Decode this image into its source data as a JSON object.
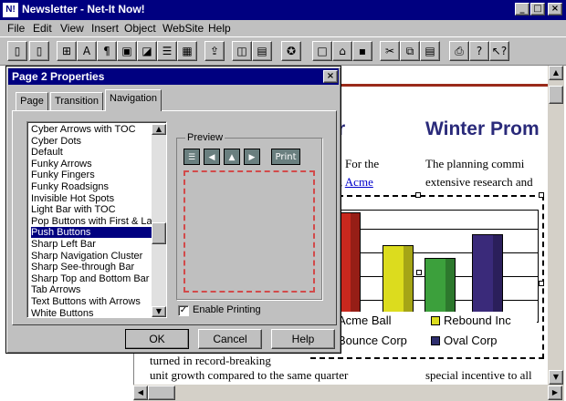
{
  "app": {
    "title": "Newsletter - Net-It Now!",
    "icon_name": "net-it-app-icon",
    "icon_glyph": "N!"
  },
  "menu": {
    "items": [
      "File",
      "Edit",
      "View",
      "Insert",
      "Object",
      "WebSite",
      "Help"
    ]
  },
  "toolbar": {
    "icons": [
      "page-icon",
      "pages-icon",
      "grid-icon",
      "text-icon",
      "format-icon",
      "image-icon",
      "hotspot-icon",
      "list-icon",
      "table-icon",
      "publish-icon",
      "navigator-icon",
      "group-icon",
      "wizard-icon",
      "new-icon",
      "open-icon",
      "save-icon",
      "cut-icon",
      "copy-icon",
      "paste-icon",
      "print-icon",
      "help-icon",
      "whats-this-icon"
    ]
  },
  "dialog": {
    "title": "Page 2 Properties",
    "tabs": [
      {
        "label": "Page",
        "active": false
      },
      {
        "label": "Transition",
        "active": false
      },
      {
        "label": "Navigation",
        "active": true
      }
    ],
    "list_items": [
      "Cyber Arrows with TOC",
      "Cyber Dots",
      "Default",
      "Funky Arrows",
      "Funky Fingers",
      "Funky Roadsigns",
      "Invisible Hot Spots",
      "Light Bar with TOC",
      "Pop Buttons with First & Last",
      "Push Buttons",
      "Sharp Left Bar",
      "Sharp Navigation Cluster",
      "Sharp See-through Bar",
      "Sharp Top and Bottom Bar",
      "Tab Arrows",
      "Text Buttons with Arrows",
      "White Buttons"
    ],
    "selected_item": "Push Buttons",
    "preview_label": "Preview",
    "preview_buttons": {
      "print_label": "Print",
      "icons": [
        "toc-icon",
        "back-arrow-icon",
        "up-arrow-icon",
        "forward-arrow-icon"
      ]
    },
    "enable_printing_label": "Enable Printing",
    "enable_printing_checked": true,
    "buttons": {
      "ok": "OK",
      "cancel": "Cancel",
      "help": "Help"
    }
  },
  "document": {
    "left_heading": "r",
    "left_text": [
      "For the",
      "Acme"
    ],
    "right_heading": "Winter Prom",
    "right_text": [
      "The  planning  commi",
      "extensive research and"
    ],
    "bottom_left": [
      "turned in record-breaking",
      "unit growth compared to the same quarter"
    ],
    "bottom_right": "special incentive to all",
    "chart": {
      "legend": [
        {
          "name": "Acme Ball",
          "color": "#2e2e6e"
        },
        {
          "name": "Rebound Inc",
          "color": "#dcdc1e"
        },
        {
          "name": "Bounce Corp",
          "color": "#c8281e"
        },
        {
          "name": "Oval Corp",
          "color": "#2e2e6e"
        }
      ],
      "bars": [
        {
          "value": 100,
          "color": "#c8281e"
        },
        {
          "value": 70,
          "color": "#dcdc1e"
        },
        {
          "value": 58,
          "color": "#3ca03c"
        },
        {
          "value": 80,
          "color": "#3a2a7a"
        }
      ],
      "legend_visible": [
        "Acme Ball",
        "Rebound Inc",
        "Bounce Corp",
        "Oval Corp"
      ]
    }
  }
}
